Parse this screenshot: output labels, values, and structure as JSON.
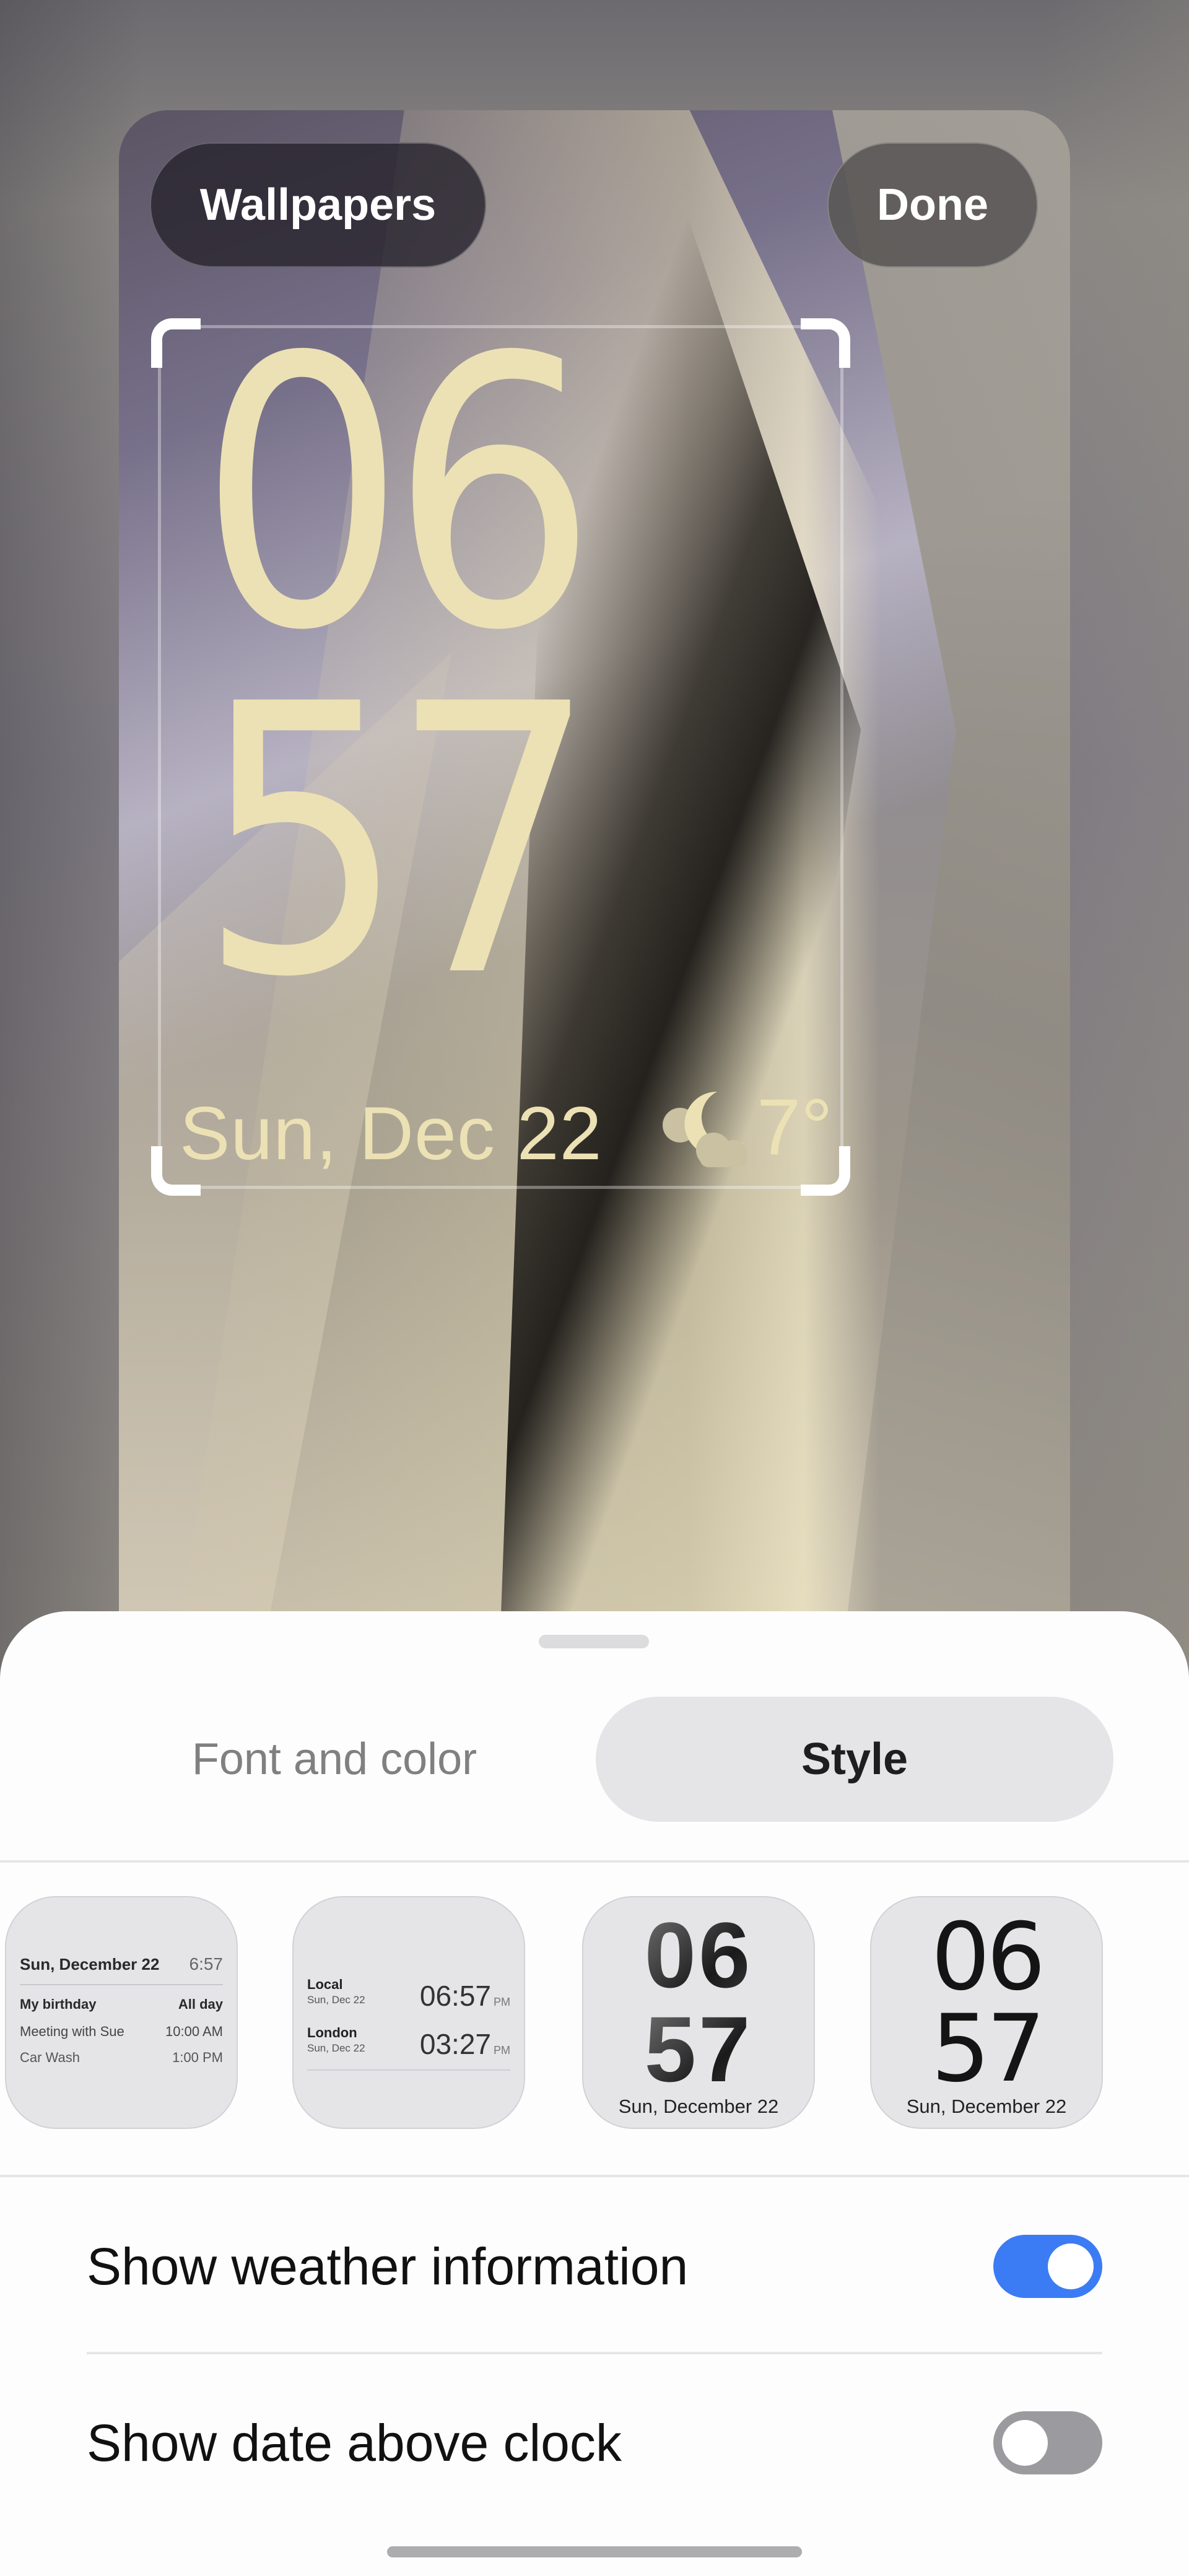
{
  "header": {
    "wallpapers_label": "Wallpapers",
    "done_label": "Done"
  },
  "lock_preview": {
    "clock_hours": "06",
    "clock_minutes": "57",
    "date": "Sun, Dec 22",
    "weather_icon": "moon-cloud-icon",
    "temperature": "7°",
    "clock_color": "#ece1b4"
  },
  "sheet": {
    "tabs": [
      {
        "label": "Font and color",
        "selected": false
      },
      {
        "label": "Style",
        "selected": true
      }
    ],
    "styles": [
      {
        "type": "calendar",
        "date": "Sun, December 22",
        "time": "6:57",
        "events": [
          {
            "title": "My birthday",
            "time": "All day"
          },
          {
            "title": "Meeting with Sue",
            "time": "10:00 AM"
          },
          {
            "title": "Car Wash",
            "time": "1:00 PM"
          }
        ]
      },
      {
        "type": "dual-clock",
        "zones": [
          {
            "name": "Local",
            "date": "Sun, Dec 22",
            "time": "06:57",
            "ampm": "PM"
          },
          {
            "name": "London",
            "date": "Sun, Dec 22",
            "time": "03:27",
            "ampm": "PM"
          }
        ]
      },
      {
        "type": "bold-gradient",
        "hours": "06",
        "minutes": "57",
        "date": "Sun, December 22"
      },
      {
        "type": "thin-line",
        "hours": "06",
        "minutes": "57",
        "date": "Sun, December 22"
      }
    ],
    "settings": [
      {
        "label": "Show weather information",
        "enabled": true
      },
      {
        "label": "Show date above clock",
        "enabled": false
      }
    ],
    "accent_color": "#3b7cf4"
  }
}
